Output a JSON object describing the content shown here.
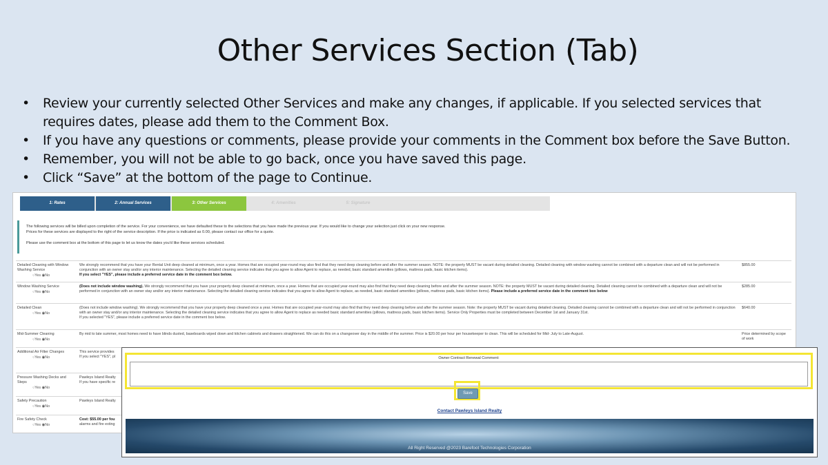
{
  "slide": {
    "title": "Other Services Section (Tab)",
    "bullets": [
      "Review your currently selected Other Services and make any changes, if applicable. If you selected services that requires dates, please add them to the Comment Box.",
      "If you have any questions or comments, please provide your comments in the Comment box before the Save Button.",
      "Remember, you will not be able to go back, once you have saved this page.",
      "Click “Save” at the bottom of the page to Continue."
    ]
  },
  "tabs": [
    {
      "label": "1: Rates"
    },
    {
      "label": "2: Annual Services"
    },
    {
      "label": "3: Other Services",
      "active": true
    },
    {
      "label": "4: Amenities"
    },
    {
      "label": "5: Signature"
    }
  ],
  "notice": {
    "line1": "The following services will be billed upon completion of the service. For your convenience, we have defaulted these to the selections that you have made the previous year. If you would like to change your selection just click on your new response.",
    "line2": "Prices for these services are displayed to the right of the service description. If the price is indicated as 0.00, please contact our office for a quote.",
    "line3": "Please use the comment box at the bottom of this page to let us know the dates you'd like these services scheduled."
  },
  "radio_labels": {
    "yes": "Yes",
    "no": "No"
  },
  "services": [
    {
      "name": "Detailed Cleaning with Window Washing Service",
      "desc": "We strongly recommend that you have your Rental Unit deep cleaned at minimum, once a year. Homes that are occupied year-round may also find that they need deep cleaning before and after the summer season. NOTE: the property MUST be vacant during detailed cleaning. Detailed cleaning with window washing cannot be combined with a departure clean and will not be performed in conjunction with an owner stay and/or any interior maintenance. Selecting the detailed cleaning service indicates that you agree to allow Agent to replace, as needed, basic standard amenities (pillows, mattress pads, basic kitchen items).",
      "note": "If you select \"YES\", please include a preferred service date in the comment box below.",
      "price": "$855.00"
    },
    {
      "name": "Window Washing Service",
      "lead": "(Does not include window washing).",
      "desc": "We strongly recommend that you have your property deep cleaned at minimum, once a year. Homes that are occupied year-round may also find that they need deep cleaning before and after the summer season. NOTE: the property MUST be vacant during detailed cleaning. Detailed cleaning cannot be combined with a departure clean and will not be performed in conjunction with an owner stay and/or any interior maintenance. Selecting the detailed cleaning service indicates that you agree to allow Agent to replace, as needed, basic standard amenities (pillows, mattress pads, basic kitchen items).",
      "note": "Please include a preferred service date in the comment box below",
      "price": "$285.00"
    },
    {
      "name": "Detailed Clean",
      "desc": "(Does not include window washing). We strongly recommend that you have your property deep cleaned once a year. Homes that are occupied year-round may also find that they need deep cleaning before and after the summer season. Note: the property MUST be vacant during detailed cleaning. Detailed cleaning cannot be combined with a departure clean and will not be performed in conjunction with an owner stay and/or any interior maintenance. Selecting the detailed cleaning service indicates that you agree to allow Agent to replace as needed basic standard amenities (pillows, mattress pads, basic kitchen items). Service Only Properties must be completed between December 1st and January 31st.",
      "note": "If you selected \"YES\", please include a preferred service date in the comment box below.",
      "price": "$640.00"
    },
    {
      "name": "Mid-Summer Cleaning",
      "desc": "By mid to late summer, most homes need to have blinds dusted, baseboards wiped down and kitchen cabinets and drawers straightened. We can do this on a changeover day in the middle of the summer. Price is $20.00 per hour per housekeeper to clean. This will be scheduled for Mid- July to Late-August.",
      "price": "Price determined by scope of work"
    },
    {
      "name": "Additional Air Filter Changes",
      "desc": "This service provides",
      "note": "If you select \"YES\", pl"
    },
    {
      "name": "Pressure Washing Decks and Steps",
      "desc": "Pawleys Island Realty",
      "note": "If you have specific re"
    },
    {
      "name": "Safety Precaution",
      "desc": "Pawleys Island Realty"
    },
    {
      "name": "Fire Safety Check",
      "lead": "Cost: $55.00 per fou",
      "note": "alarms and fire exting"
    }
  ],
  "comment": {
    "label": "Owner Contract Renewal Comment:",
    "value": ""
  },
  "save_label": "Save",
  "contact_link": "Contact Pawleys Island Realty",
  "footer_text": "All Right Reserved @2023 Barefoot Technologies Corporation",
  "colors": {
    "tab_done": "#2e5f8a",
    "tab_active": "#8cc63e",
    "highlight": "#f4e533",
    "save_button": "#6f9ab3"
  }
}
